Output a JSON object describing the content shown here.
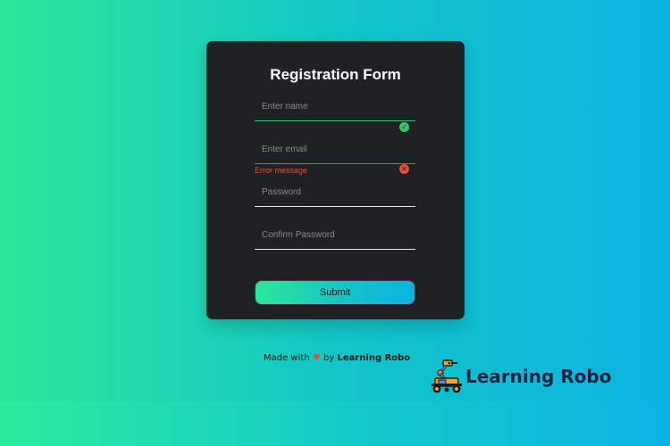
{
  "form": {
    "title": "Registration Form",
    "fields": [
      {
        "placeholder": "Enter name",
        "value": "",
        "state": "success"
      },
      {
        "placeholder": "Enter email",
        "value": "",
        "state": "error"
      },
      {
        "placeholder": "Password",
        "value": "",
        "state": "default"
      },
      {
        "placeholder": "Confirm Password",
        "value": "",
        "state": "default"
      }
    ],
    "error_message": "Error message",
    "submit_label": "Submit"
  },
  "footer": {
    "made_with": "Made with",
    "heart": "♥",
    "by": "by",
    "author": "Learning Robo"
  },
  "brand": {
    "name": "Learning Robo",
    "icon": "robot-icon"
  },
  "colors": {
    "success": "#2ecc71",
    "error": "#e74c3c",
    "card": "#202124",
    "gradient_start": "#2be89a",
    "gradient_end": "#0cb3e2"
  }
}
